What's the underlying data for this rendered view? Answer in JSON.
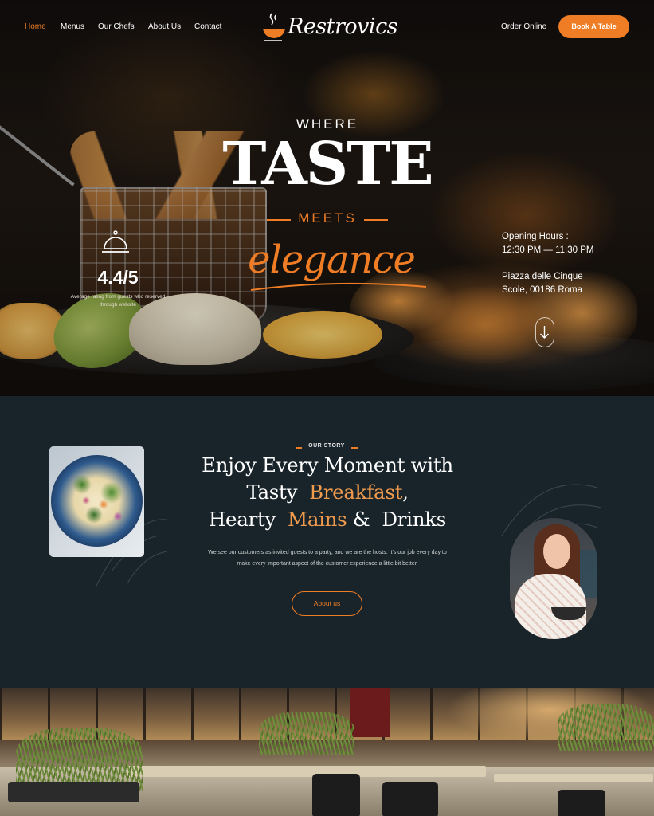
{
  "nav": {
    "links": [
      {
        "label": "Home",
        "active": true
      },
      {
        "label": "Menus"
      },
      {
        "label": "Our Chefs"
      },
      {
        "label": "About Us"
      },
      {
        "label": "Contact"
      }
    ],
    "brand": "Restrovics",
    "order_online": "Order Online",
    "book_button": "Book A Table"
  },
  "hero": {
    "line1": "WHERE",
    "line2": "TASTE",
    "line3": "MEETS",
    "line4": "elegance",
    "rating": "4.4/5",
    "rating_note": "Average rating from guests who reserved through website",
    "hours_label": "Opening Hours :",
    "hours": "12:30 PM — 11:30 PM",
    "address_line1": "Piazza delle Cinque",
    "address_line2": "Scole, 00186 Roma"
  },
  "story": {
    "label": "OUR STORY",
    "heading_line1": "Enjoy Every Moment with",
    "heading_tasty": "Tasty",
    "heading_breakfast": "Breakfast",
    "heading_comma": ",",
    "heading_hearty": "Hearty",
    "heading_mains": "Mains",
    "heading_amp": "&",
    "heading_drinks": "Drinks",
    "description": "We see our customers as invited guests to a party, and we are the hosts. It's our job every day to make every important aspect of the customer experience a little bit better.",
    "button": "About us"
  },
  "colors": {
    "accent": "#ef7d25",
    "story_bg": "#18242a"
  },
  "icons": [
    "bowl-logo-icon",
    "cloche-icon",
    "arrow-down-icon"
  ]
}
